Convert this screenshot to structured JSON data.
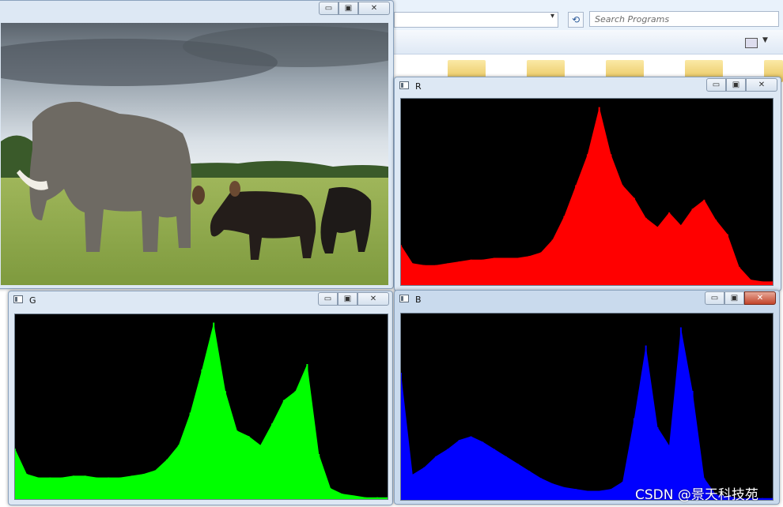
{
  "explorer": {
    "search_placeholder": "Search Programs",
    "addr_chevron": "▾",
    "refresh_glyph": "⟲"
  },
  "windows": {
    "image": {
      "title": "",
      "controls": {
        "min": "▭",
        "max": "▣",
        "close": "✕"
      }
    },
    "red": {
      "title": "R",
      "controls": {
        "min": "▭",
        "max": "▣",
        "close": "✕"
      },
      "color": "#ff0000"
    },
    "green": {
      "title": "G",
      "controls": {
        "min": "▭",
        "max": "▣",
        "close": "✕"
      },
      "color": "#00ff00"
    },
    "blue": {
      "title": "B",
      "controls": {
        "min": "▭",
        "max": "▣",
        "close": "✕"
      },
      "color": "#0000ff"
    }
  },
  "chart_data": [
    {
      "type": "area",
      "series": [
        {
          "color": "#ff0000",
          "x": [
            0,
            8,
            16,
            24,
            32,
            40,
            48,
            56,
            64,
            72,
            80,
            88,
            96,
            104,
            112,
            120,
            128,
            136,
            144,
            152,
            160,
            168,
            176,
            184,
            192,
            200,
            208,
            216,
            224,
            232,
            240,
            248,
            255
          ],
          "values": [
            0.22,
            0.12,
            0.11,
            0.11,
            0.12,
            0.13,
            0.14,
            0.14,
            0.15,
            0.15,
            0.15,
            0.16,
            0.18,
            0.25,
            0.38,
            0.55,
            0.72,
            0.98,
            0.72,
            0.55,
            0.48,
            0.37,
            0.32,
            0.4,
            0.33,
            0.42,
            0.47,
            0.36,
            0.28,
            0.1,
            0.03,
            0.02,
            0.02
          ]
        }
      ]
    },
    {
      "type": "area",
      "series": [
        {
          "color": "#00ff00",
          "x": [
            0,
            8,
            16,
            24,
            32,
            40,
            48,
            56,
            64,
            72,
            80,
            88,
            96,
            104,
            112,
            120,
            128,
            136,
            144,
            152,
            160,
            168,
            176,
            184,
            192,
            200,
            208,
            216,
            224,
            232,
            240,
            248,
            255
          ],
          "values": [
            0.28,
            0.14,
            0.12,
            0.12,
            0.12,
            0.13,
            0.13,
            0.12,
            0.12,
            0.12,
            0.13,
            0.14,
            0.16,
            0.22,
            0.3,
            0.48,
            0.72,
            0.98,
            0.6,
            0.38,
            0.35,
            0.3,
            0.42,
            0.55,
            0.6,
            0.75,
            0.25,
            0.06,
            0.03,
            0.02,
            0.01,
            0.01,
            0.01
          ]
        }
      ]
    },
    {
      "type": "area",
      "series": [
        {
          "color": "#0000ff",
          "x": [
            0,
            8,
            16,
            24,
            32,
            40,
            48,
            56,
            64,
            72,
            80,
            88,
            96,
            104,
            112,
            120,
            128,
            136,
            144,
            152,
            160,
            168,
            176,
            184,
            192,
            200,
            208,
            216,
            224,
            232,
            240,
            248,
            255
          ],
          "values": [
            0.7,
            0.14,
            0.18,
            0.24,
            0.28,
            0.33,
            0.35,
            0.32,
            0.28,
            0.24,
            0.2,
            0.16,
            0.12,
            0.09,
            0.07,
            0.06,
            0.05,
            0.05,
            0.06,
            0.1,
            0.45,
            0.85,
            0.4,
            0.3,
            0.95,
            0.6,
            0.12,
            0.03,
            0.02,
            0.01,
            0.01,
            0.01,
            0.01
          ]
        }
      ]
    }
  ],
  "watermark": "CSDN @景天科技苑"
}
